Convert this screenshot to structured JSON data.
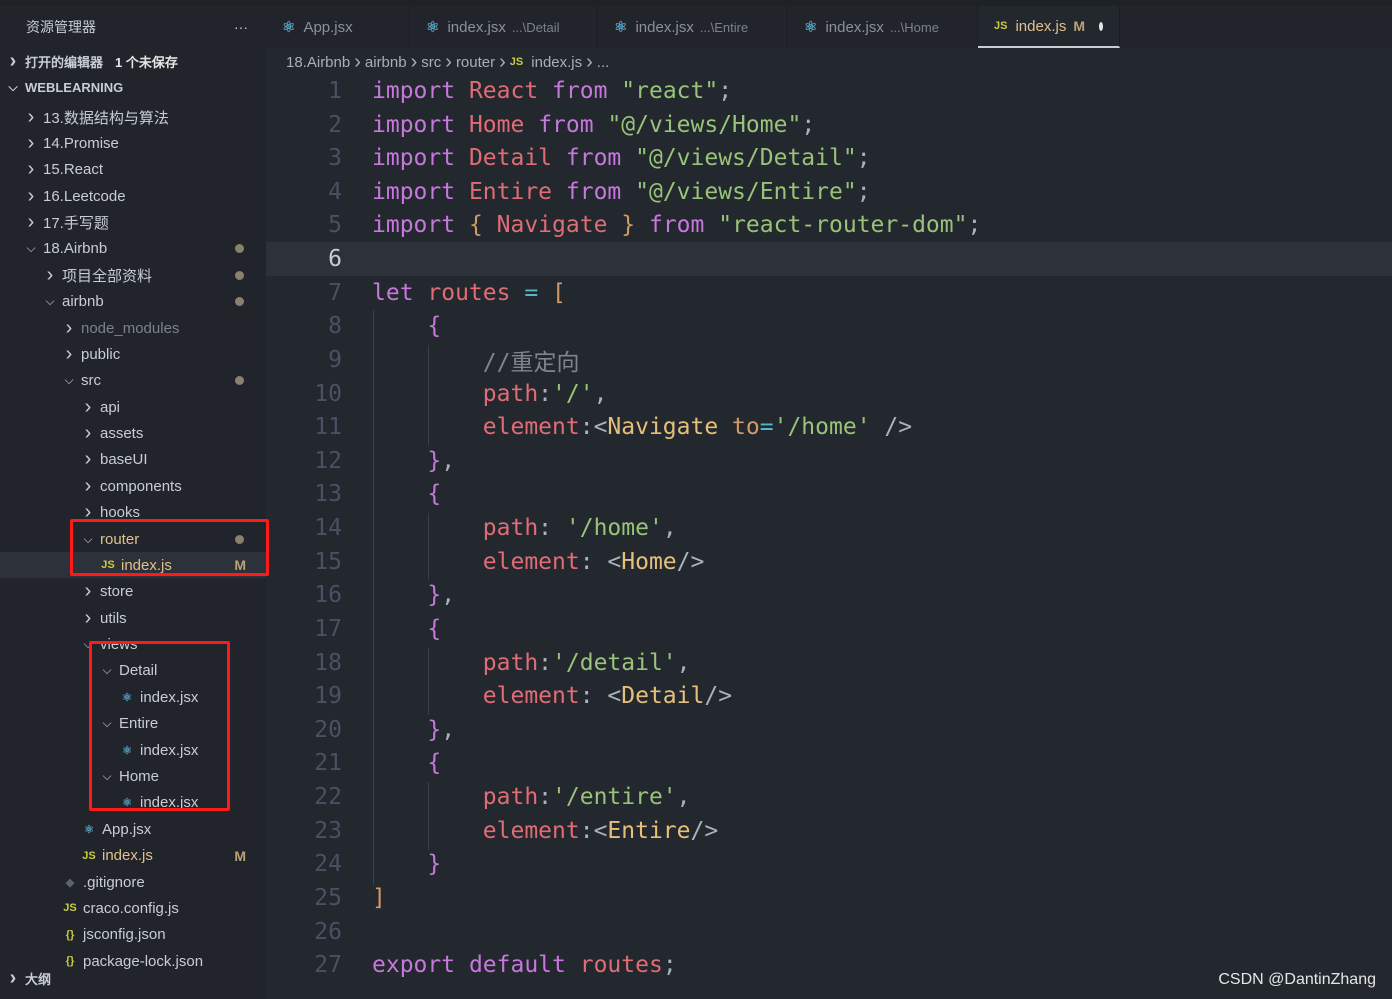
{
  "sidebar": {
    "title": "资源管理器",
    "more": "···",
    "items": [
      {
        "label": "打开的编辑器",
        "extra": "1 个未保存",
        "depth": 0,
        "chev": "right",
        "bold": true
      },
      {
        "label": "WEBLEARNING",
        "depth": 0,
        "chev": "down",
        "bold": true
      },
      {
        "label": "13.数据结构与算法",
        "depth": 1,
        "chev": "right"
      },
      {
        "label": "14.Promise",
        "depth": 1,
        "chev": "right"
      },
      {
        "label": "15.React",
        "depth": 1,
        "chev": "right"
      },
      {
        "label": "16.Leetcode",
        "depth": 1,
        "chev": "right"
      },
      {
        "label": "17.手写题",
        "depth": 1,
        "chev": "right"
      },
      {
        "label": "18.Airbnb",
        "depth": 1,
        "chev": "down",
        "dot": true
      },
      {
        "label": "项目全部资料",
        "depth": 2,
        "chev": "right",
        "dot": true
      },
      {
        "label": "airbnb",
        "depth": 2,
        "chev": "down",
        "dot": true
      },
      {
        "label": "node_modules",
        "depth": 3,
        "chev": "right",
        "dim": true
      },
      {
        "label": "public",
        "depth": 3,
        "chev": "right"
      },
      {
        "label": "src",
        "depth": 3,
        "chev": "down",
        "dot": true
      },
      {
        "label": "api",
        "depth": 4,
        "chev": "right"
      },
      {
        "label": "assets",
        "depth": 4,
        "chev": "right"
      },
      {
        "label": "baseUI",
        "depth": 4,
        "chev": "right"
      },
      {
        "label": "components",
        "depth": 4,
        "chev": "right"
      },
      {
        "label": "hooks",
        "depth": 4,
        "chev": "right"
      },
      {
        "label": "router",
        "depth": 4,
        "chev": "down",
        "dot": true,
        "mod": true
      },
      {
        "label": "index.js",
        "depth": 5,
        "icon": "js",
        "badge": "M",
        "mod": true,
        "selected": true
      },
      {
        "label": "store",
        "depth": 4,
        "chev": "right"
      },
      {
        "label": "utils",
        "depth": 4,
        "chev": "right"
      },
      {
        "label": "views",
        "depth": 4,
        "chev": "down"
      },
      {
        "label": "Detail",
        "depth": 5,
        "chev": "down"
      },
      {
        "label": "index.jsx",
        "depth": 6,
        "icon": "react"
      },
      {
        "label": "Entire",
        "depth": 5,
        "chev": "down"
      },
      {
        "label": "index.jsx",
        "depth": 6,
        "icon": "react"
      },
      {
        "label": "Home",
        "depth": 5,
        "chev": "down"
      },
      {
        "label": "index.jsx",
        "depth": 6,
        "icon": "react"
      },
      {
        "label": "App.jsx",
        "depth": 4,
        "icon": "react"
      },
      {
        "label": "index.js",
        "depth": 4,
        "icon": "js",
        "badge": "M",
        "mod": true
      },
      {
        "label": ".gitignore",
        "depth": 3,
        "icon": "git"
      },
      {
        "label": "craco.config.js",
        "depth": 3,
        "icon": "js"
      },
      {
        "label": "jsconfig.json",
        "depth": 3,
        "icon": "json"
      },
      {
        "label": "package-lock.json",
        "depth": 3,
        "icon": "json"
      },
      {
        "label": "大纲",
        "depth": 0,
        "chev": "right",
        "bold": true
      }
    ]
  },
  "tabs": [
    {
      "label": "App.jsx",
      "icon": "react"
    },
    {
      "label": "index.jsx",
      "sub": "...\\Detail",
      "icon": "react"
    },
    {
      "label": "index.jsx",
      "sub": "...\\Entire",
      "icon": "react"
    },
    {
      "label": "index.jsx",
      "sub": "...\\Home",
      "icon": "react"
    },
    {
      "label": "index.js",
      "icon": "js",
      "badge": "M",
      "unsaved": true,
      "active": true
    }
  ],
  "breadcrumb": [
    "18.Airbnb",
    "airbnb",
    "src",
    "router",
    "index.js",
    "..."
  ],
  "editor": {
    "current_line": 6,
    "lines": [
      [
        [
          "kw",
          "import "
        ],
        [
          "var",
          "React "
        ],
        [
          "kw",
          "from "
        ],
        [
          "str",
          "\"react\""
        ],
        [
          "pn",
          ";"
        ]
      ],
      [
        [
          "kw",
          "import "
        ],
        [
          "var",
          "Home "
        ],
        [
          "kw",
          "from "
        ],
        [
          "str",
          "\"@/views/Home\""
        ],
        [
          "pn",
          ";"
        ]
      ],
      [
        [
          "kw",
          "import "
        ],
        [
          "var",
          "Detail "
        ],
        [
          "kw",
          "from "
        ],
        [
          "str",
          "\"@/views/Detail\""
        ],
        [
          "pn",
          ";"
        ]
      ],
      [
        [
          "kw",
          "import "
        ],
        [
          "var",
          "Entire "
        ],
        [
          "kw",
          "from "
        ],
        [
          "str",
          "\"@/views/Entire\""
        ],
        [
          "pn",
          ";"
        ]
      ],
      [
        [
          "kw",
          "import "
        ],
        [
          "br1",
          "{ "
        ],
        [
          "var",
          "Navigate "
        ],
        [
          "br1",
          "} "
        ],
        [
          "kw",
          "from "
        ],
        [
          "str",
          "\"react-router-dom\""
        ],
        [
          "pn",
          ";"
        ]
      ],
      [],
      [
        [
          "kw",
          "let "
        ],
        [
          "var",
          "routes "
        ],
        [
          "op",
          "= "
        ],
        [
          "br1",
          "["
        ]
      ],
      [
        [
          "pn",
          "    "
        ],
        [
          "br2",
          "{"
        ]
      ],
      [
        [
          "pn",
          "        "
        ],
        [
          "cm",
          "//重定向"
        ]
      ],
      [
        [
          "pn",
          "        "
        ],
        [
          "var",
          "path"
        ],
        [
          "pn",
          ":"
        ],
        [
          "str",
          "'/'"
        ],
        [
          "pn",
          ","
        ]
      ],
      [
        [
          "pn",
          "        "
        ],
        [
          "var",
          "element"
        ],
        [
          "pn",
          ":<"
        ],
        [
          "tag",
          "Navigate "
        ],
        [
          "br1",
          "to"
        ],
        [
          "op",
          "="
        ],
        [
          "str",
          "'/home'"
        ],
        [
          "pn",
          " />"
        ]
      ],
      [
        [
          "pn",
          "    "
        ],
        [
          "br2",
          "}"
        ],
        [
          "pn",
          ","
        ]
      ],
      [
        [
          "pn",
          "    "
        ],
        [
          "br2",
          "{"
        ]
      ],
      [
        [
          "pn",
          "        "
        ],
        [
          "var",
          "path"
        ],
        [
          "pn",
          ": "
        ],
        [
          "str",
          "'/home'"
        ],
        [
          "pn",
          ","
        ]
      ],
      [
        [
          "pn",
          "        "
        ],
        [
          "var",
          "element"
        ],
        [
          "pn",
          ": <"
        ],
        [
          "tag",
          "Home"
        ],
        [
          "pn",
          "/>"
        ]
      ],
      [
        [
          "pn",
          "    "
        ],
        [
          "br2",
          "}"
        ],
        [
          "pn",
          ","
        ]
      ],
      [
        [
          "pn",
          "    "
        ],
        [
          "br2",
          "{"
        ]
      ],
      [
        [
          "pn",
          "        "
        ],
        [
          "var",
          "path"
        ],
        [
          "pn",
          ":"
        ],
        [
          "str",
          "'/detail'"
        ],
        [
          "pn",
          ","
        ]
      ],
      [
        [
          "pn",
          "        "
        ],
        [
          "var",
          "element"
        ],
        [
          "pn",
          ": <"
        ],
        [
          "tag",
          "Detail"
        ],
        [
          "pn",
          "/>"
        ]
      ],
      [
        [
          "pn",
          "    "
        ],
        [
          "br2",
          "}"
        ],
        [
          "pn",
          ","
        ]
      ],
      [
        [
          "pn",
          "    "
        ],
        [
          "br2",
          "{"
        ]
      ],
      [
        [
          "pn",
          "        "
        ],
        [
          "var",
          "path"
        ],
        [
          "pn",
          ":"
        ],
        [
          "str",
          "'/entire'"
        ],
        [
          "pn",
          ","
        ]
      ],
      [
        [
          "pn",
          "        "
        ],
        [
          "var",
          "element"
        ],
        [
          "pn",
          ":<"
        ],
        [
          "tag",
          "Entire"
        ],
        [
          "pn",
          "/>"
        ]
      ],
      [
        [
          "pn",
          "    "
        ],
        [
          "br2",
          "}"
        ]
      ],
      [
        [
          "br1",
          "]"
        ]
      ],
      [],
      [
        [
          "kw",
          "export "
        ],
        [
          "kw",
          "default "
        ],
        [
          "var",
          "routes"
        ],
        [
          "pn",
          ";"
        ]
      ]
    ]
  },
  "watermark": "CSDN @DantinZhang",
  "colors": {
    "accent_red_box": "#ff1a1a",
    "keyword": "#c678dd",
    "variable": "#e06c75",
    "string": "#98c379",
    "tag": "#e5c07b"
  }
}
